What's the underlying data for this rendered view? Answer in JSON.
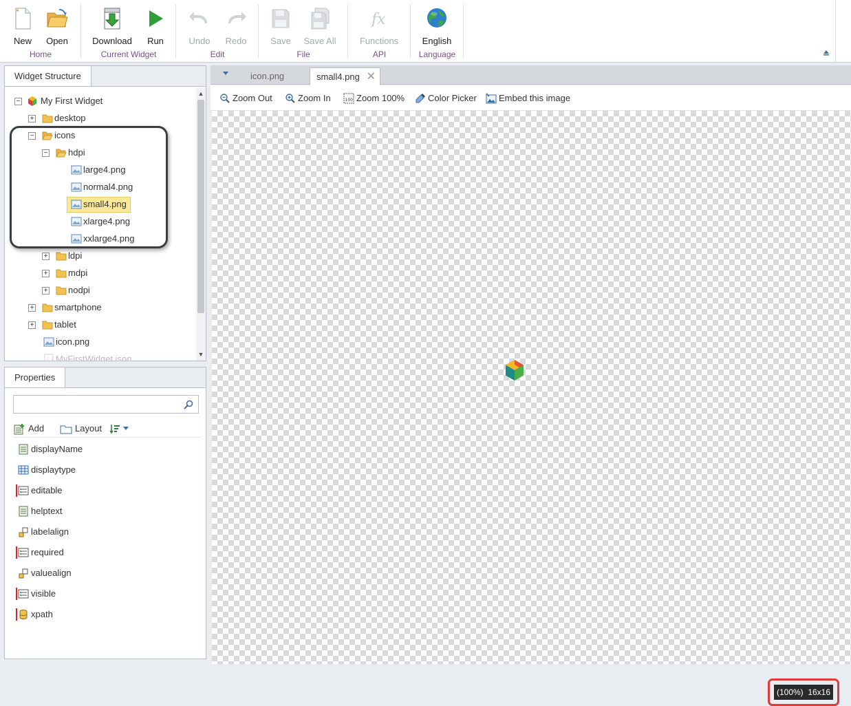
{
  "ribbon": {
    "groups": [
      {
        "label": "Home",
        "buttons": [
          {
            "label": "New",
            "icon": "new-document-icon"
          },
          {
            "label": "Open",
            "icon": "open-folder-icon"
          }
        ]
      },
      {
        "label": "Current Widget",
        "buttons": [
          {
            "label": "Download",
            "icon": "download-icon"
          },
          {
            "label": "Run",
            "icon": "run-icon"
          }
        ]
      },
      {
        "label": "Edit",
        "buttons": [
          {
            "label": "Undo",
            "icon": "undo-icon"
          },
          {
            "label": "Redo",
            "icon": "redo-icon"
          }
        ]
      },
      {
        "label": "File",
        "buttons": [
          {
            "label": "Save",
            "icon": "save-icon"
          },
          {
            "label": "Save All",
            "icon": "save-all-icon"
          }
        ]
      },
      {
        "label": "API",
        "buttons": [
          {
            "label": "Functions",
            "icon": "functions-icon"
          }
        ]
      },
      {
        "label": "Language",
        "buttons": [
          {
            "label": "English",
            "icon": "globe-icon"
          }
        ]
      }
    ]
  },
  "widget_structure": {
    "tab_label": "Widget Structure",
    "tree": [
      {
        "label": "My First Widget",
        "icon": "widget-icon",
        "expander": "−"
      },
      {
        "label": "desktop",
        "icon": "folder-icon",
        "expander": "+"
      },
      {
        "label": "icons",
        "icon": "folder-open-icon",
        "expander": "−"
      },
      {
        "label": "hdpi",
        "icon": "folder-open-icon",
        "expander": "−"
      },
      {
        "label": "large4.png",
        "icon": "image-file-icon"
      },
      {
        "label": "normal4.png",
        "icon": "image-file-icon"
      },
      {
        "label": "small4.png",
        "icon": "image-file-icon",
        "selected": true
      },
      {
        "label": "xlarge4.png",
        "icon": "image-file-icon"
      },
      {
        "label": "xxlarge4.png",
        "icon": "image-file-icon"
      },
      {
        "label": "ldpi",
        "icon": "folder-icon",
        "expander": "+"
      },
      {
        "label": "mdpi",
        "icon": "folder-icon",
        "expander": "+"
      },
      {
        "label": "nodpi",
        "icon": "folder-icon",
        "expander": "+"
      },
      {
        "label": "smartphone",
        "icon": "folder-icon",
        "expander": "+"
      },
      {
        "label": "tablet",
        "icon": "folder-icon",
        "expander": "+"
      },
      {
        "label": "icon.png",
        "icon": "image-file-icon"
      },
      {
        "label": "MyFirstWidget.json",
        "icon": "json-file-icon",
        "faded": true
      }
    ]
  },
  "properties": {
    "tab_label": "Properties",
    "search_placeholder": "",
    "toolbar": {
      "add_label": "Add",
      "layout_label": "Layout"
    },
    "items": [
      {
        "label": "displayName",
        "required": false,
        "icon": "text-field-icon"
      },
      {
        "label": "displaytype",
        "required": false,
        "icon": "grid-field-icon"
      },
      {
        "label": "editable",
        "required": true,
        "icon": "option-field-icon"
      },
      {
        "label": "helptext",
        "required": false,
        "icon": "text-field-icon"
      },
      {
        "label": "labelalign",
        "required": false,
        "icon": "align-field-icon"
      },
      {
        "label": "required",
        "required": true,
        "icon": "option-field-icon"
      },
      {
        "label": "valuealign",
        "required": false,
        "icon": "align-field-icon"
      },
      {
        "label": "visible",
        "required": true,
        "icon": "option-field-icon"
      },
      {
        "label": "xpath",
        "required": true,
        "icon": "database-icon"
      }
    ]
  },
  "editor": {
    "tabs": [
      {
        "label": "icon.png",
        "active": false
      },
      {
        "label": "small4.png",
        "active": true,
        "closable": true
      }
    ],
    "toolbar": [
      {
        "label": "Zoom Out",
        "icon": "zoom-out-icon"
      },
      {
        "label": "Zoom In",
        "icon": "zoom-in-icon"
      },
      {
        "label": "Zoom 100%",
        "icon": "zoom-100-icon"
      },
      {
        "label": "Color Picker",
        "icon": "color-picker-icon"
      },
      {
        "label": "Embed this image",
        "icon": "embed-image-icon"
      }
    ],
    "zoom_info": {
      "zoom": "(100%)",
      "size": "16x16"
    }
  },
  "colors": {
    "accent_purple": "#7a4f8a",
    "selection": "#fde996",
    "highlight_red": "#e23b3b",
    "required_marker": "#d9262b"
  }
}
